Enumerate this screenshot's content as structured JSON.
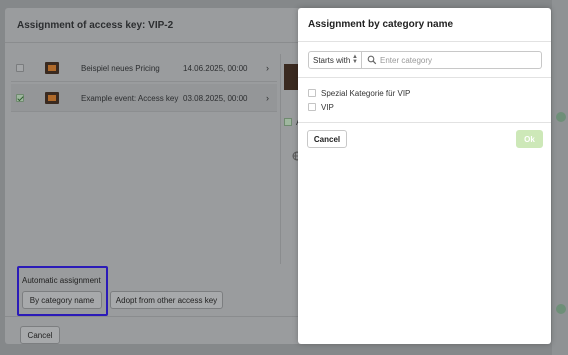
{
  "modal": {
    "title": "Assignment of access key: VIP-2",
    "rows": [
      {
        "name": "Beispiel neues Pricing",
        "date": "14.06.2025, 00:00",
        "checked": false
      },
      {
        "name": "Example event: Access key",
        "date": "03.08.2025, 00:00",
        "checked": true
      }
    ],
    "row_chevron": "›",
    "mid_letter": "A",
    "automatic_assignment_label": "Automatic assignment",
    "by_category_button": "By category name",
    "adopt_button": "Adopt from other access key",
    "cancel_button": "Cancel"
  },
  "dialog": {
    "title": "Assignment by category name",
    "match_mode": "Starts with",
    "search_placeholder": "Enter category",
    "search_value": "",
    "categories": [
      {
        "label": "Spezial Kategorie für VIP",
        "checked": false
      },
      {
        "label": "VIP",
        "checked": false
      }
    ],
    "cancel_button": "Cancel",
    "ok_button": "Ok"
  },
  "icons": {
    "search": "search-icon",
    "select_arrows": "select-arrows-icon",
    "globe": "globe-icon"
  },
  "colors": {
    "accent_ok": "#cde8b8",
    "focus_outline": "#2b1bb8",
    "checked_green": "#9fb79f"
  }
}
